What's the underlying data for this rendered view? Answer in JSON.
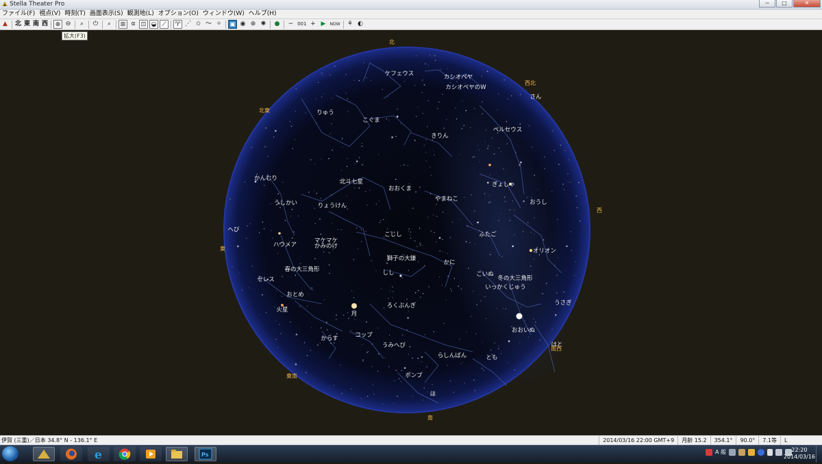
{
  "window": {
    "title": "Stella Theater Pro",
    "buttons": [
      "─",
      "□",
      "✕"
    ]
  },
  "menu": [
    "ファイル(F)",
    "視点(V)",
    "時刻(T)",
    "画面表示(S)",
    "観測地(L)",
    "オプション(O)",
    "ウィンドウ(W)",
    "ヘルプ(H)"
  ],
  "toolbar": {
    "directions": [
      "北",
      "東",
      "南",
      "西"
    ],
    "counter": "001",
    "now_label": "NOW",
    "tooltip": "拡大(F3)"
  },
  "sky": {
    "directions": [
      {
        "name": "北"
      },
      {
        "name": "北東"
      },
      {
        "name": "東"
      },
      {
        "name": "東南"
      },
      {
        "name": "南"
      },
      {
        "name": "南西"
      },
      {
        "name": "西"
      },
      {
        "name": "西北"
      }
    ],
    "labels": [
      "ケフェウス",
      "カシオペヤ",
      "カシオペヤのW",
      "りゅう",
      "こぐま",
      "さん",
      "ペルセウス",
      "きりん",
      "かんむり",
      "北斗七星",
      "おおくま",
      "ぎょしゃ",
      "うしかい",
      "りょうけん",
      "やまねこ",
      "おうし",
      "へび",
      "ふたご",
      "ハウメア",
      "マケマケ",
      "かみのけ",
      "こじし",
      "オリオン",
      "獅子の大鎌",
      "かに",
      "春の大三角形",
      "しし",
      "こいぬ",
      "冬の大三角形",
      "セレス",
      "いっかくじゅう",
      "おとめ",
      "うさぎ",
      "火星",
      "月",
      "ろくぶんぎ",
      "おおいぬ",
      "からす",
      "コップ",
      "うみへび",
      "はと",
      "らしんばん",
      "とも",
      "ポンプ",
      "ほ"
    ]
  },
  "status": {
    "location": "伊賀 (三重)／日本  34.8° N - 136.1° E",
    "fields": [
      "2014/03/16  22:00  GMT+9",
      "月齢 15.2",
      "354.1°",
      "90.0°",
      "7.1等",
      "L"
    ]
  },
  "taskbar": {
    "tray_ime": "A 般",
    "clock_time": "22:20",
    "clock_date": "2014/03/16"
  },
  "colors": {
    "background": "#1f1c13",
    "sky_rim": "#1a2a7a",
    "direction_label": "#f0b64a",
    "active_tool": "#2a7ab8"
  }
}
